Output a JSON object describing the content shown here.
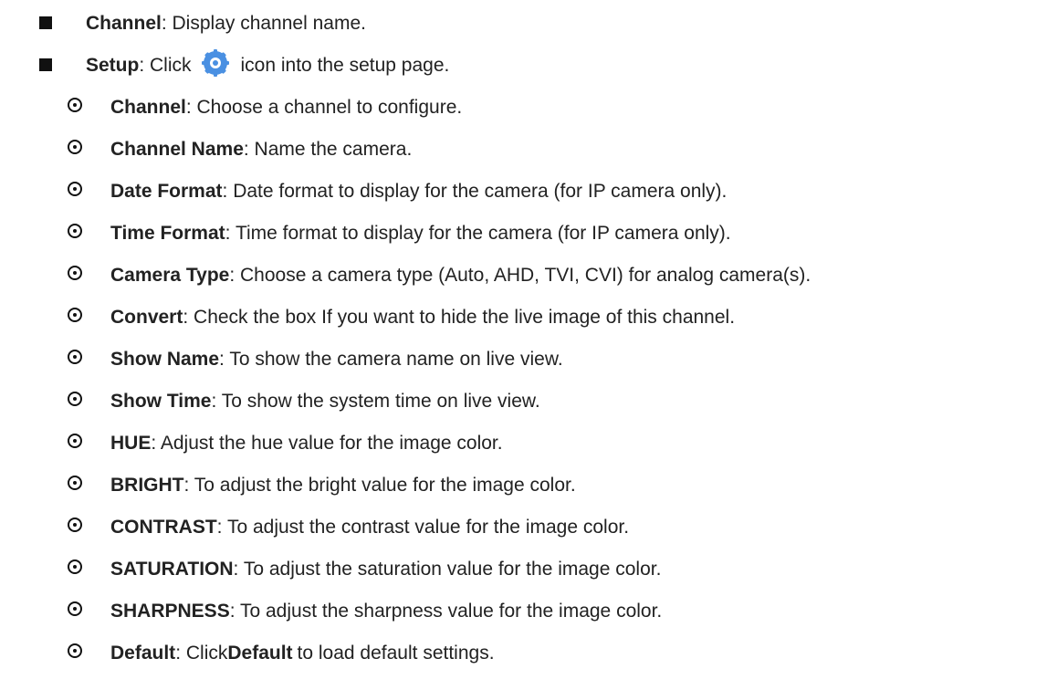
{
  "items": [
    {
      "term": "Channel",
      "desc": ": Display channel name."
    },
    {
      "term": "Setup",
      "desc_before_icon": ": Click",
      "icon": "gear-icon",
      "desc_after_icon": "icon into the setup page."
    }
  ],
  "subitems": [
    {
      "term": "Channel",
      "desc": ": Choose a channel to configure."
    },
    {
      "term": "Channel Name",
      "desc": ": Name the camera."
    },
    {
      "term": "Date Format",
      "desc": ": Date format to display for the camera (for IP camera only)."
    },
    {
      "term": "Time Format",
      "desc": ": Time format to display for the camera (for IP camera only)."
    },
    {
      "term": "Camera Type",
      "desc": ": Choose a camera type (Auto, AHD, TVI, CVI) for analog camera(s)."
    },
    {
      "term": "Convert",
      "desc": ": Check the box If you want to hide the live image of this channel."
    },
    {
      "term": "Show Name",
      "desc": ": To show the camera name on live view."
    },
    {
      "term": "Show Time",
      "desc": ": To show the system time on live view."
    },
    {
      "term": "HUE",
      "desc": ": Adjust the hue value for the image color."
    },
    {
      "term": "BRIGHT",
      "desc": ": To adjust the bright value for the image color."
    },
    {
      "term": "CONTRAST",
      "desc": ": To adjust the contrast value for the image color."
    },
    {
      "term": "SATURATION",
      "desc": ": To adjust the saturation value for the image color."
    },
    {
      "term": "SHARPNESS",
      "desc": ": To adjust the sharpness value for the image color."
    },
    {
      "term": "Default",
      "desc_before_bold": ": Click",
      "bold": "Default",
      "desc_after_bold": "to load default settings."
    }
  ],
  "colors": {
    "text": "#222222",
    "bullet": "#111111",
    "gear_fill": "#4a90e2"
  }
}
